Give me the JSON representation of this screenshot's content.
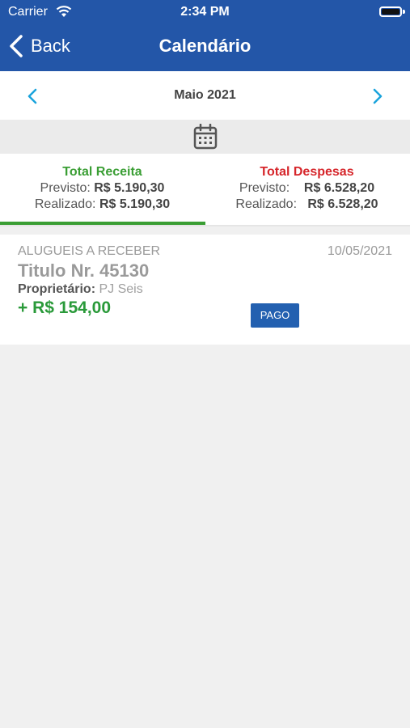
{
  "status_bar": {
    "carrier": "Carrier",
    "time": "2:34 PM"
  },
  "nav": {
    "back_label": "Back",
    "title": "Calendário"
  },
  "month": {
    "label": "Maio 2021"
  },
  "totals": {
    "receita": {
      "title": "Total Receita",
      "previsto_label": "Previsto:",
      "previsto_value": "R$ 5.190,30",
      "realizado_label": "Realizado:",
      "realizado_value": "R$ 5.190,30"
    },
    "despesas": {
      "title": "Total Despesas",
      "previsto_label": "Previsto:",
      "previsto_value": "R$ 6.528,20",
      "realizado_label": "Realizado:",
      "realizado_value": "R$ 6.528,20"
    }
  },
  "entries": [
    {
      "type": "ALUGUEIS A RECEBER",
      "date": "10/05/2021",
      "title": "Titulo Nr. 45130",
      "owner_label": "Proprietário:",
      "owner_value": "PJ Seis",
      "amount": "+ R$ 154,00",
      "status": "PAGO"
    }
  ],
  "colors": {
    "header": "#2356a8",
    "receita": "#3a9e34",
    "despesas": "#d6262b",
    "badge": "#2360b0"
  }
}
